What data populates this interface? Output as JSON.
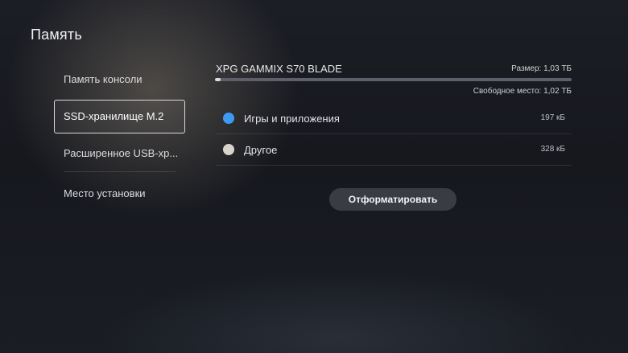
{
  "page": {
    "title": "Память"
  },
  "sidebar": {
    "items": [
      {
        "label": "Память консоли"
      },
      {
        "label": "SSD-хранилище M.2"
      },
      {
        "label": "Расширенное USB-хр..."
      },
      {
        "label": "Место установки"
      }
    ],
    "selected_index": 1
  },
  "drive": {
    "name": "XPG GAMMIX S70 BLADE",
    "size_text": "Размер: 1,03 ТБ",
    "free_text": "Свободное место: 1,02 ТБ",
    "used_fraction": 0.01
  },
  "categories": [
    {
      "label": "Игры и приложения",
      "value": "197 кБ",
      "color": "#3b9bf2"
    },
    {
      "label": "Другое",
      "value": "328 кБ",
      "color": "#d8d4cc"
    }
  ],
  "actions": {
    "format_label": "Отформатировать"
  },
  "colors": {
    "bar_fill": "#d9dbe2",
    "bar_track": "#5d606a"
  }
}
